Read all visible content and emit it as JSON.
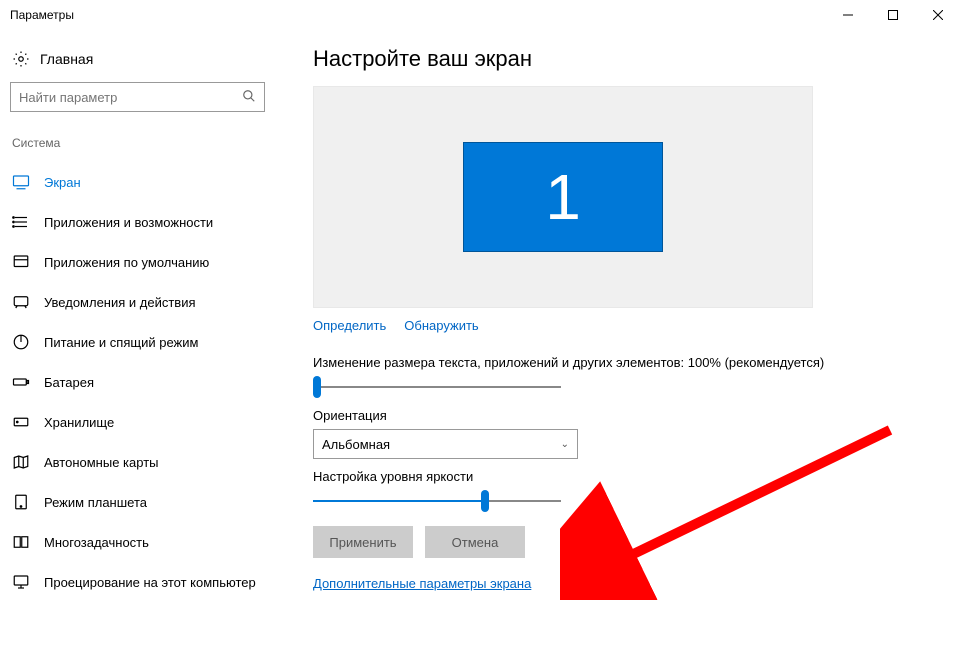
{
  "window": {
    "title": "Параметры"
  },
  "sidebar": {
    "home_label": "Главная",
    "search_placeholder": "Найти параметр",
    "category": "Система",
    "items": [
      {
        "label": "Экран",
        "active": true
      },
      {
        "label": "Приложения и возможности",
        "active": false
      },
      {
        "label": "Приложения по умолчанию",
        "active": false
      },
      {
        "label": "Уведомления и действия",
        "active": false
      },
      {
        "label": "Питание и спящий режим",
        "active": false
      },
      {
        "label": "Батарея",
        "active": false
      },
      {
        "label": "Хранилище",
        "active": false
      },
      {
        "label": "Автономные карты",
        "active": false
      },
      {
        "label": "Режим планшета",
        "active": false
      },
      {
        "label": "Многозадачность",
        "active": false
      },
      {
        "label": "Проецирование на этот компьютер",
        "active": false
      }
    ]
  },
  "main": {
    "title": "Настройте ваш экран",
    "monitor_number": "1",
    "identify": "Определить",
    "detect": "Обнаружить",
    "scaling_label": "Изменение размера текста, приложений и других элементов: 100% (рекомендуется)",
    "orientation_label": "Ориентация",
    "orientation_value": "Альбомная",
    "brightness_label": "Настройка уровня яркости",
    "apply": "Применить",
    "cancel": "Отмена",
    "advanced_link": "Дополнительные параметры экрана"
  },
  "colors": {
    "accent": "#0078d7",
    "link": "#0066c5",
    "arrow": "#ff0000"
  }
}
